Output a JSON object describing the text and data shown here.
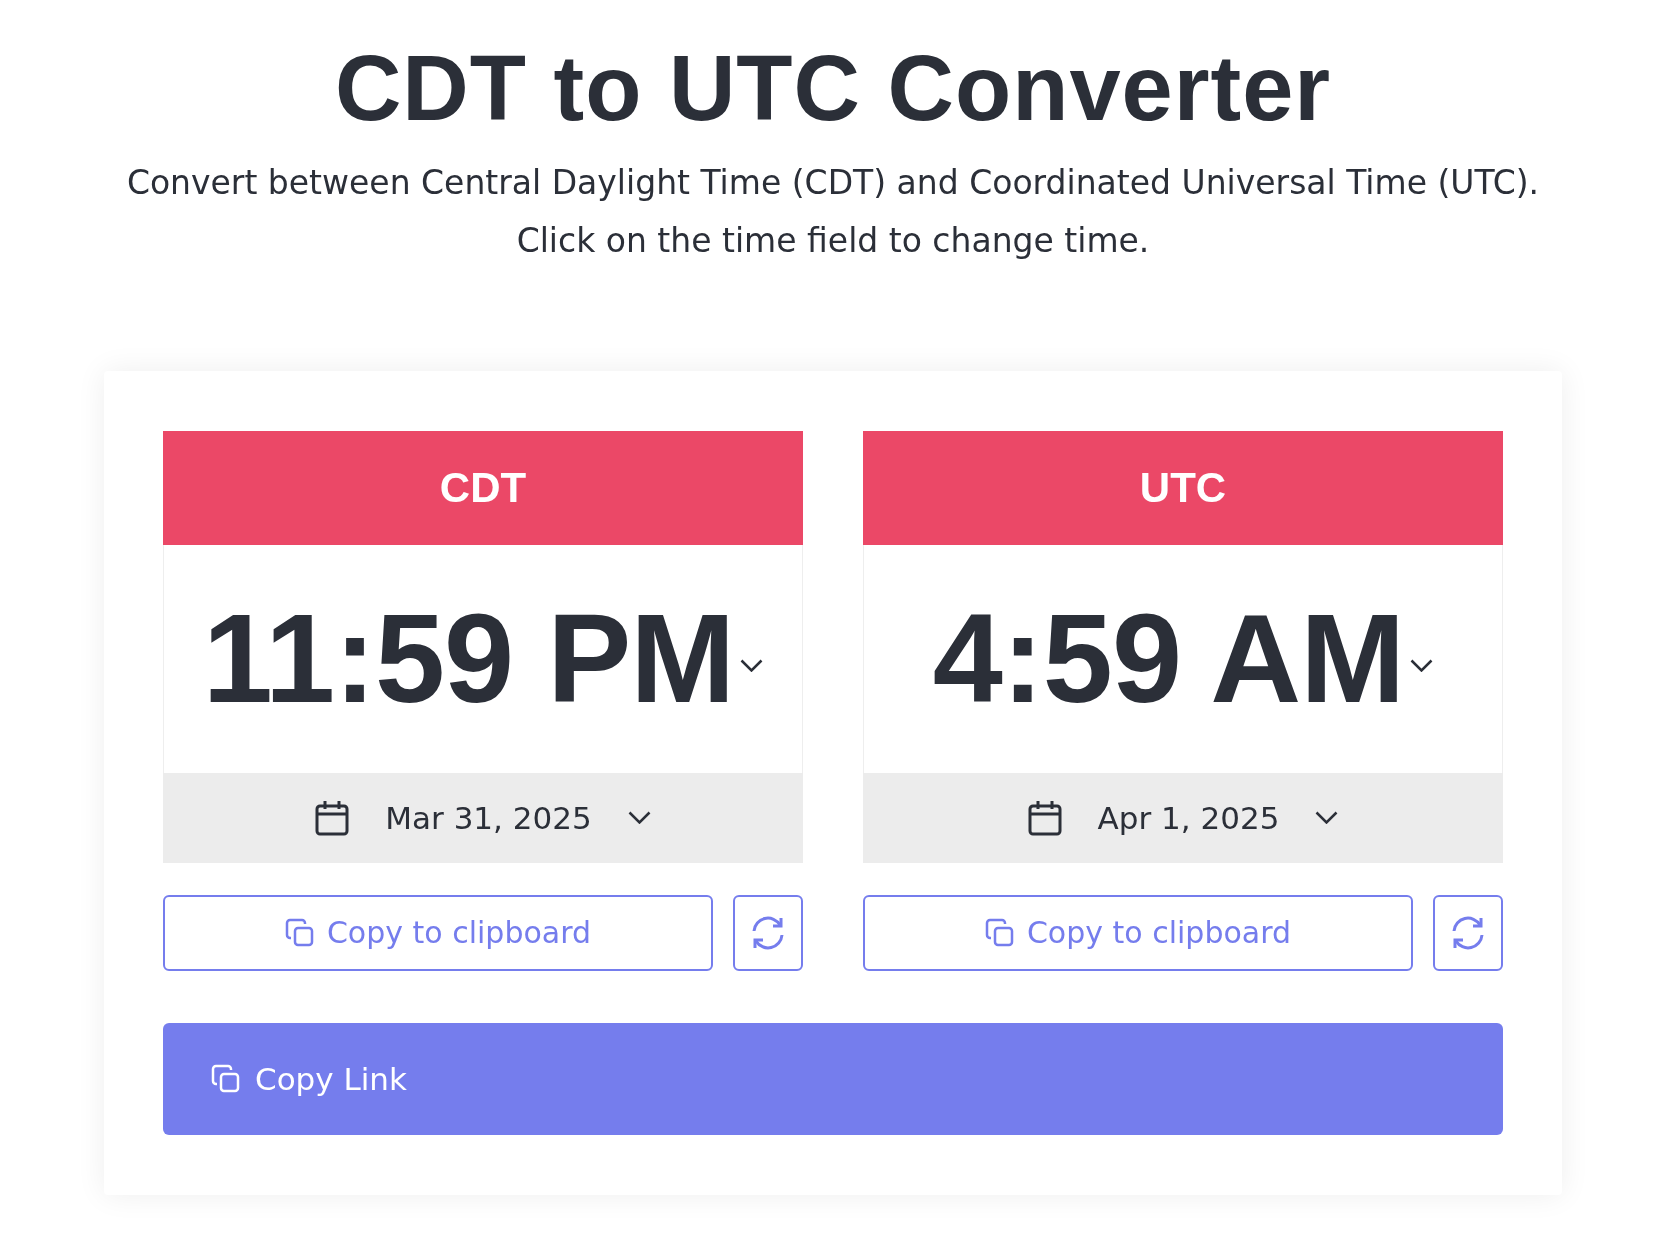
{
  "title": "CDT to UTC Converter",
  "subtitle": [
    "Convert between Central Daylight Time (CDT) and Coordinated Universal Time (UTC).",
    "Click on the time field to change time."
  ],
  "converters": [
    {
      "zone": "CDT",
      "time": "11:59 PM",
      "date": "Mar 31, 2025",
      "copy_label": "Copy to clipboard"
    },
    {
      "zone": "UTC",
      "time": "4:59 AM",
      "date": "Apr 1, 2025",
      "copy_label": "Copy to clipboard"
    }
  ],
  "copy_link": "Copy Link"
}
